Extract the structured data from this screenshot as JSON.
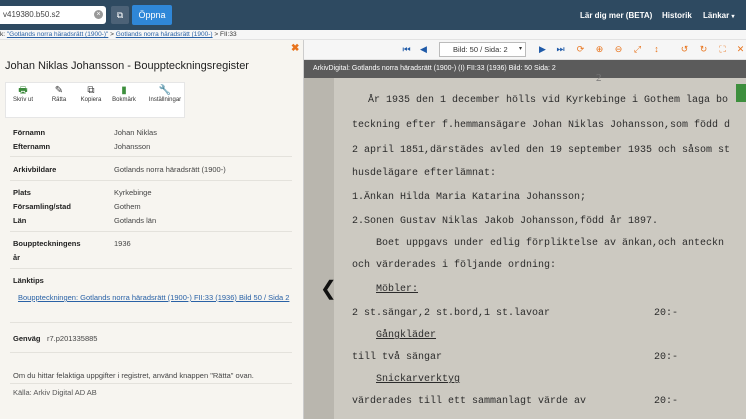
{
  "topbar": {
    "search_value": "v419380.b50.s2",
    "clear_icon": "×",
    "open_label": "Öppna",
    "nav": [
      "Lär dig mer (BETA)",
      "Historik",
      "Länkar"
    ]
  },
  "breadcrumb": {
    "prefix": "k: ",
    "items": [
      "\"Gotlands norra häradsrätt (1900-)\"",
      "Gotlands norra häradsrätt (1900-)",
      "FII:33"
    ],
    "separator": " > "
  },
  "toolbar": {
    "page_select": "Bild: 50 / Sida: 2"
  },
  "viewer": {
    "header": "ArkivDigital: Gotlands norra häradsrätt (1900-) (I) FII:33 (1936) Bild: 50 Sida: 2",
    "doc_lines": [
      "År 1935 den 1 december hölls vid Kyrkebinge i Gothem laga bo",
      "teckning efter f.hemmansägare Johan Niklas Johansson,som född d",
      "2 april 1851,därstädes avled den 19 september 1935 och såsom st",
      "husdelägare efterlämnat:",
      "1.Änkan Hilda Maria Katarina Johansson;",
      "2.Sonen Gustav Niklas Jakob Johansson,född år 1897.",
      "Boet uppgavs under edlig förpliktelse av änkan,och anteckn",
      "och värderades i följande ordning:",
      "Möbler:",
      "2 st.sängar,2 st.bord,1 st.lavoar",
      "Gångkläder",
      "till två sängar",
      "Snickarverktyg",
      "värderades till ett sammanlagt värde av",
      "20:-",
      "20:-",
      "20:-"
    ]
  },
  "panel": {
    "title": "Johan Niklas Johansson - Bouppteckningsregister",
    "actions": [
      {
        "label": "Skriv ut",
        "icon": "printer-icon"
      },
      {
        "label": "Rätta",
        "icon": "edit-icon"
      },
      {
        "label": "Kopiera",
        "icon": "copy-icon"
      },
      {
        "label": "Bokmärk",
        "icon": "bookmark-icon"
      },
      {
        "label": "Inställningar",
        "icon": "wrench-icon"
      }
    ],
    "fields": {
      "fornamn_label": "Förnamn",
      "fornamn": "Johan Niklas",
      "efternamn_label": "Efternamn",
      "efternamn": "Johansson",
      "arkivbildare_label": "Arkivbildare",
      "arkivbildare": "Gotlands norra häradsrätt (1900-)",
      "plats_label": "Plats",
      "plats": "Kyrkebinge",
      "forsamling_label": "Församling/stad",
      "forsamling": "Gothem",
      "lan_label": "Län",
      "lan": "Gotlands län",
      "ar_label1": "Bouppteckningens",
      "ar_label2": "år",
      "ar": "1936"
    },
    "lanktips_label": "Länktips",
    "lanktips_link": "Bouppteckningen: Gotlands norra häradsrätt (1900-) FII:33 (1936) Bild 50 / Sida 2",
    "genvag_label": "Genväg",
    "genvag": "r7.p201335885",
    "note": "Om du hittar felaktiga uppgifter i registret, använd knappen \"Rätta\" ovan.",
    "source": "Källa: Arkiv Digital AD AB"
  }
}
